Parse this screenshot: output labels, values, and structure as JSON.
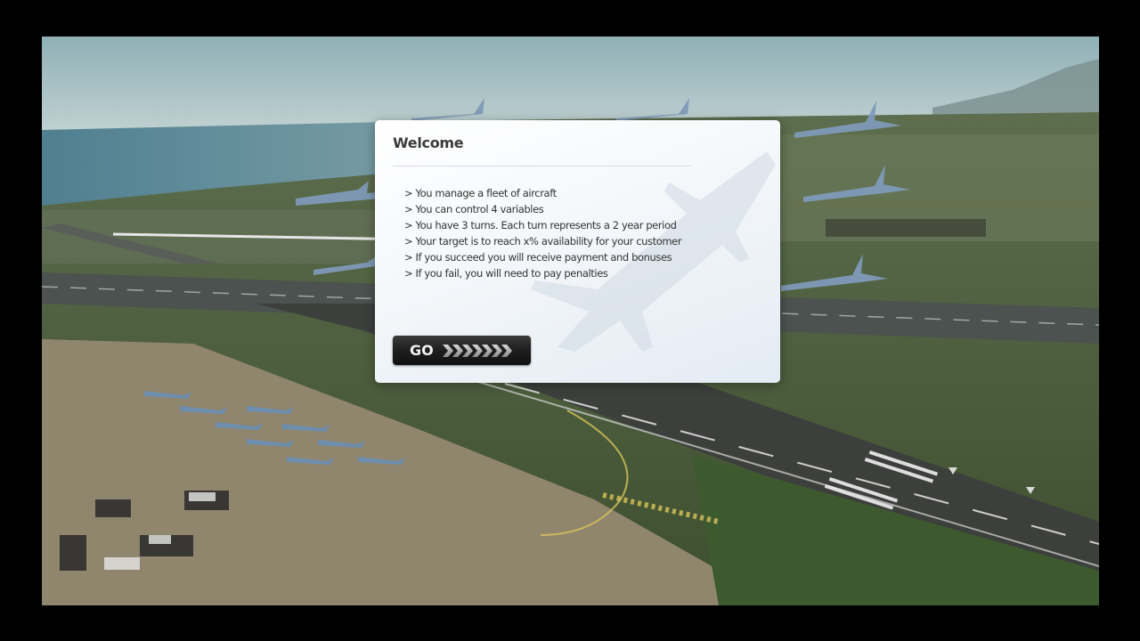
{
  "dialog": {
    "title": "Welcome",
    "bullets": [
      "> You manage a fleet of aircraft",
      "> You can control 4 variables",
      "> You have 3 turns. Each turn represents a 2 year period",
      "> Your target is to reach x% availability for your customer",
      "> If you succeed you will receive payment and bonuses",
      "> If you fail, you will need to pay penalties"
    ],
    "go_label": "GO"
  },
  "colors": {
    "dialog_background": "#f4f7fa",
    "button_background": "#1e1e1e",
    "frame": "#000000"
  },
  "scene": {
    "description_icons": [
      "fighter-jet-icon",
      "runway",
      "parked-aircraft"
    ]
  }
}
